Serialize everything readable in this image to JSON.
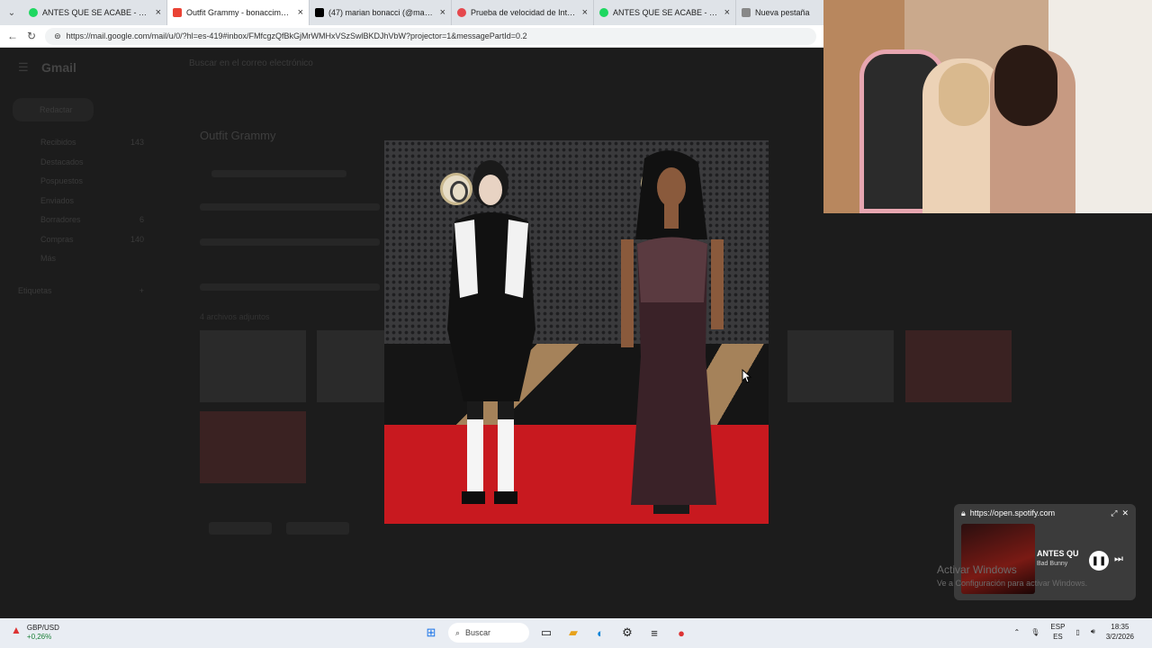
{
  "browser": {
    "tabs": [
      {
        "title": "ANTES QUE SE ACABE - Bad Bunny",
        "color": "#1ed760",
        "active": false
      },
      {
        "title": "Outfit Grammy - bonaccimarianel",
        "color": "#ea4335",
        "active": true
      },
      {
        "title": "(47) marian bonacci (@marianbona",
        "color": "#000000",
        "active": false
      },
      {
        "title": "Prueba de velocidad de Internet | F",
        "color": "#e5484d",
        "active": false
      },
      {
        "title": "ANTES QUE SE ACABE - Bad B",
        "color": "#1ed760",
        "active": false
      },
      {
        "title": "Nueva pestaña",
        "color": "#888888",
        "active": false
      }
    ],
    "url": "https://mail.google.com/mail/u/0/?hl=es-419#inbox/FMfcgzQfBkGjMrWMHxVSzSwlBKDJhVbW?projector=1&messagePartId=0.2"
  },
  "gmail": {
    "logo": "Gmail",
    "search_placeholder": "Buscar en el correo electrónico",
    "compose": "Redactar",
    "sidebar": [
      {
        "label": "Recibidos",
        "count": "143"
      },
      {
        "label": "Destacados",
        "count": ""
      },
      {
        "label": "Pospuestos",
        "count": ""
      },
      {
        "label": "Enviados",
        "count": ""
      },
      {
        "label": "Borradores",
        "count": "6"
      },
      {
        "label": "Compras",
        "count": "140"
      },
      {
        "label": "Más",
        "count": ""
      }
    ],
    "labels_header": "Etiquetas",
    "subject": "Outfit Grammy",
    "attachments_label": "4 archivos adjuntos"
  },
  "spotify": {
    "url": "https://open.spotify.com",
    "track": "ANTES QU",
    "artist": "Bad Bunny"
  },
  "watermark": {
    "title": "Activar Windows",
    "subtitle": "Ve a Configuración para activar Windows."
  },
  "taskbar": {
    "ticker": "GBP/USD",
    "change": "+0,26%",
    "search": "Buscar",
    "lang": "ESP",
    "region": "ES",
    "time": "18:35",
    "date": "3/2/2026"
  }
}
